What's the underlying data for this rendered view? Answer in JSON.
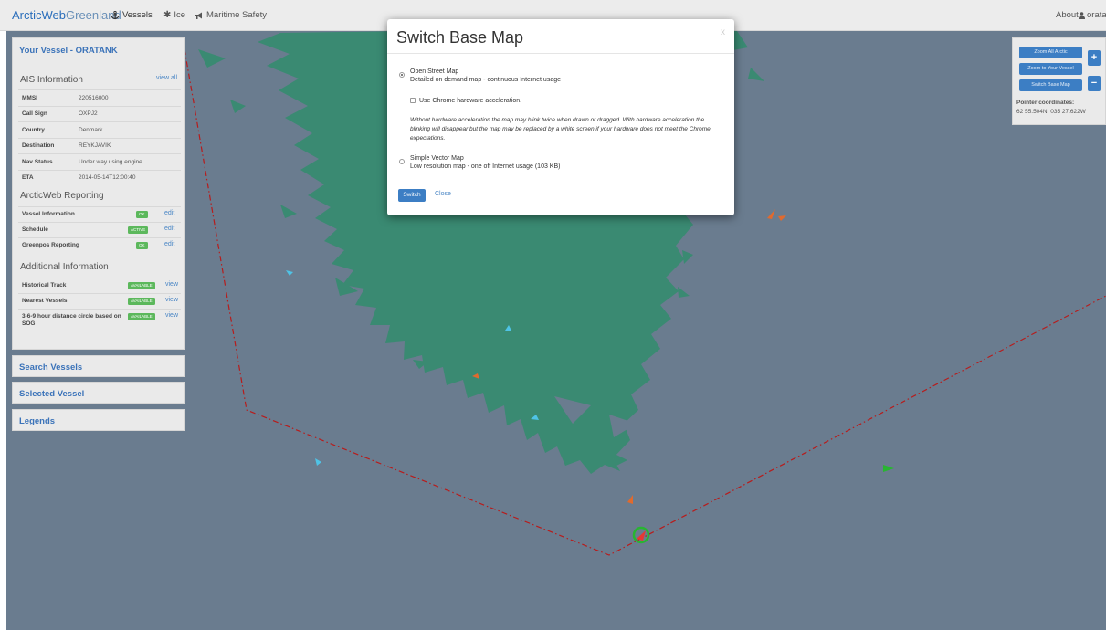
{
  "navbar": {
    "brand_part1": "ArcticWeb",
    "brand_part2": "Greenland",
    "items": [
      {
        "icon": "anchor-icon",
        "label": "Vessels",
        "active": true
      },
      {
        "icon": "snowflake-icon",
        "label": "Ice",
        "active": false
      },
      {
        "icon": "megaphone-icon",
        "label": "Maritime Safety",
        "active": false
      }
    ],
    "about": "About",
    "user": "orata"
  },
  "vessel_panel": {
    "title": "Your Vessel - ORATANK",
    "ais_title": "AIS Information",
    "view_all": "view all",
    "ais": [
      {
        "key": "MMSI",
        "value": "220516000"
      },
      {
        "key": "Call Sign",
        "value": "OXPJ2"
      },
      {
        "key": "Country",
        "value": "Denmark"
      },
      {
        "key": "Destination",
        "value": "REYKJAVIK"
      },
      {
        "key": "Nav Status",
        "value": "Under way using engine"
      },
      {
        "key": "ETA",
        "value": "2014-05-14T12:00:40"
      }
    ],
    "reporting_title": "ArcticWeb Reporting",
    "reporting": [
      {
        "label": "Vessel Information",
        "badge": "OK",
        "action": "edit"
      },
      {
        "label": "Schedule",
        "badge": "ACTIVE",
        "action": "edit"
      },
      {
        "label": "Greenpos Reporting",
        "badge": "OK",
        "action": "edit"
      }
    ],
    "additional_title": "Additional Information",
    "additional": [
      {
        "label": "Historical Track",
        "badge": "AVAILABLE",
        "action": "view"
      },
      {
        "label": "Nearest Vessels",
        "badge": "AVAILABLE",
        "action": "view"
      },
      {
        "label": "3-6-9 hour distance circle based on SOG",
        "badge": "AVAILABLE",
        "action": "view"
      }
    ]
  },
  "collapsed_panels": [
    "Search Vessels",
    "Selected Vessel",
    "Legends"
  ],
  "controls": {
    "zoom_all_arctic": "Zoom All Arctic",
    "zoom_to_vessel": "Zoom to Your Vessel",
    "switch_base_map": "Switch Base Map",
    "zoom_in": "+",
    "zoom_out": "−",
    "pointer_label": "Pointer coordinates:",
    "pointer_value": "62 55.504N, 035 27.622W"
  },
  "modal": {
    "title": "Switch Base Map",
    "close_x": "x",
    "option1_title": "Open Street Map",
    "option1_desc": "Detailed on demand map - continuous Internet usage",
    "option1_selected": true,
    "checkbox_label": "Use Chrome hardware acceleration.",
    "checkbox_checked": false,
    "note": "Without hardware acceleration the map may blink twice when drawn or dragged. With hardware acceleration the blinking will disappear but the map may be replaced by a white screen if your hardware does not meet the Chrome expectations.",
    "option2_title": "Simple Vector Map",
    "option2_desc": "Low resolution map - one off Internet usage (103 KB)",
    "option2_selected": false,
    "switch_button": "Switch",
    "close_link": "Close"
  },
  "colors": {
    "sea": "#6a7c8f",
    "land": "#3a8a72",
    "accent": "#3c7ec4",
    "ok_badge": "#5cb85c",
    "boundary": "#b71c1c"
  }
}
